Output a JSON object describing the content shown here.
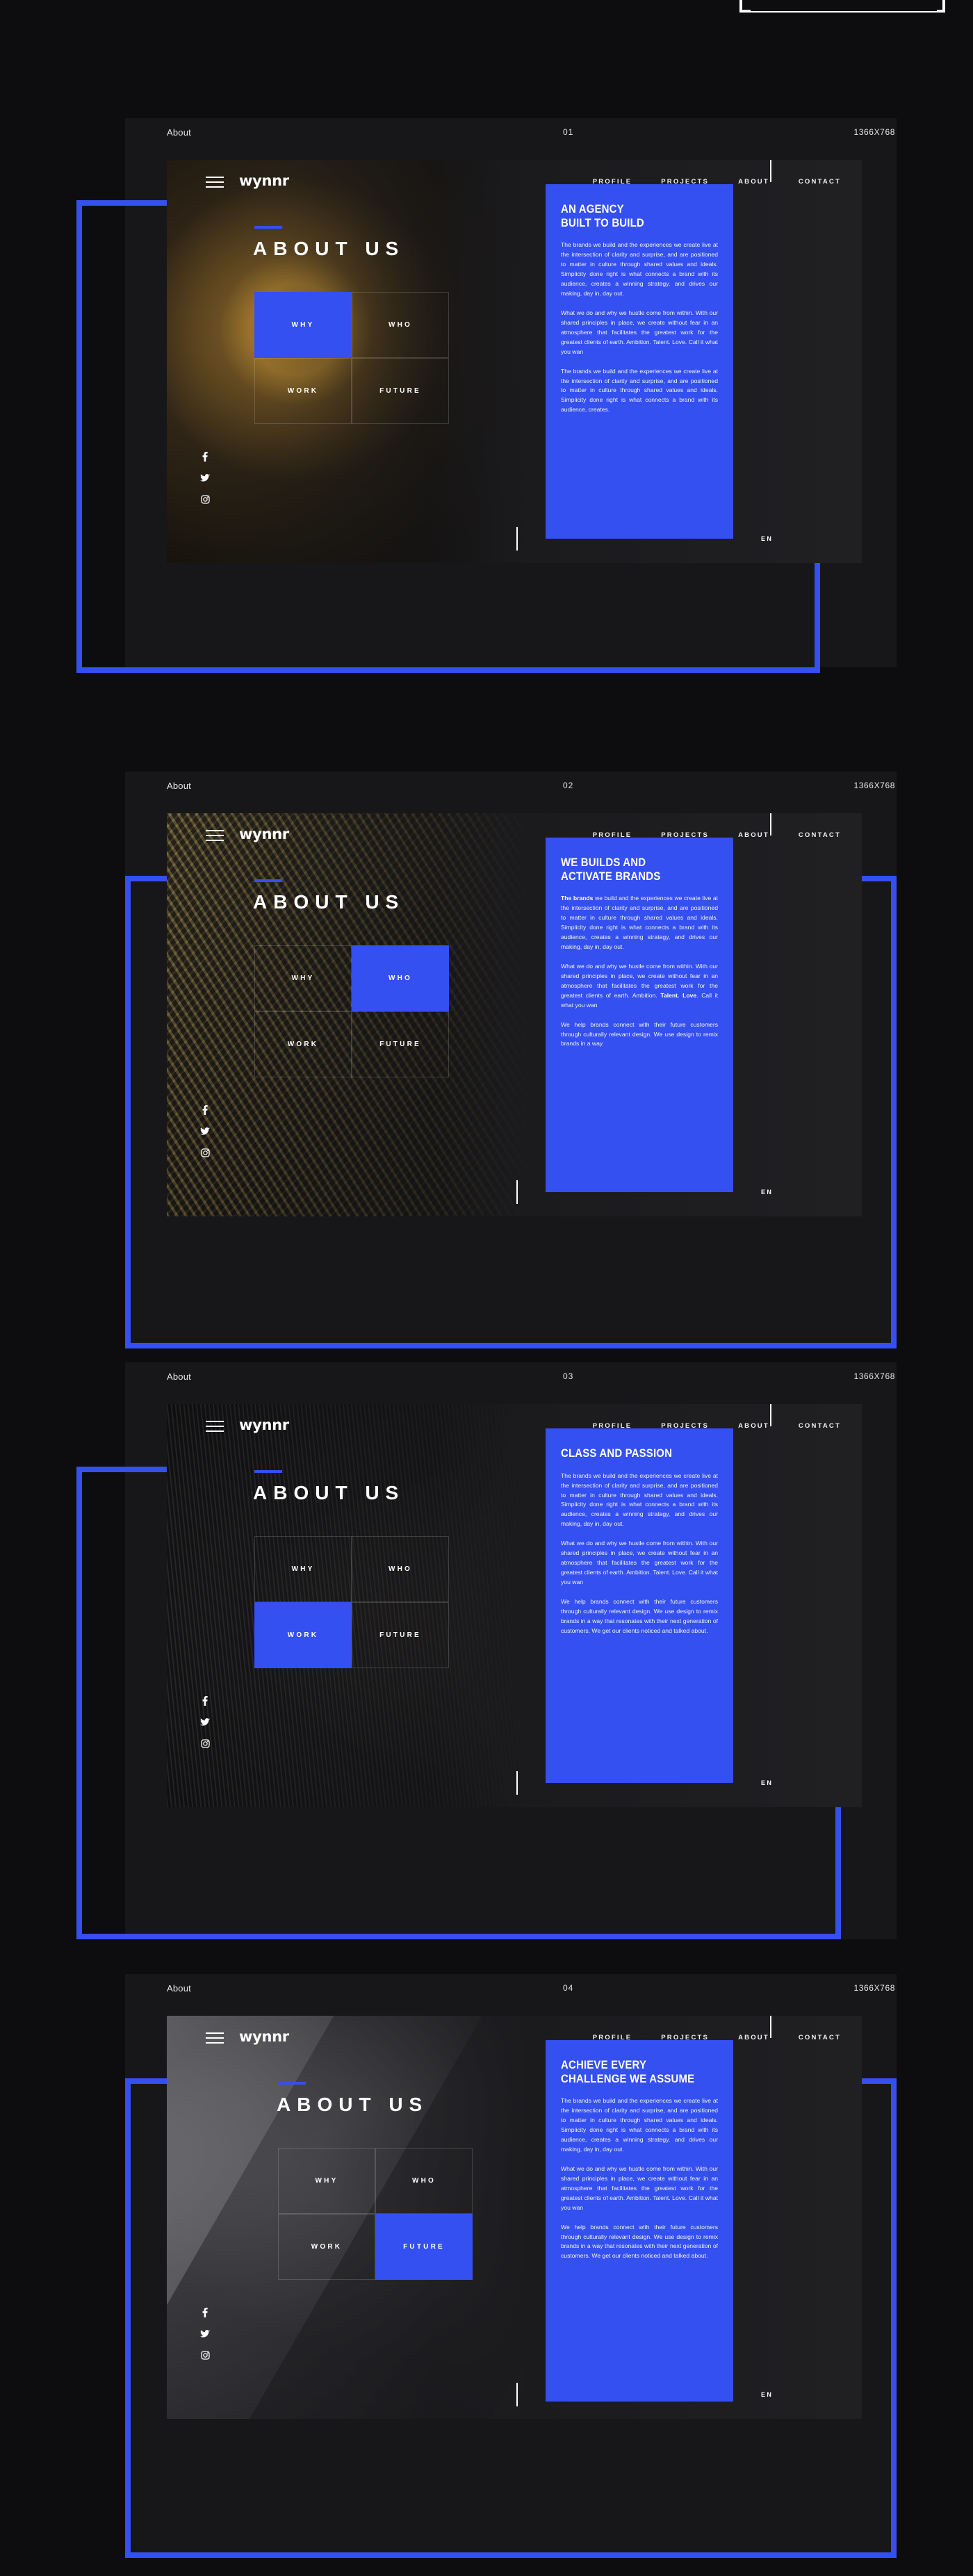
{
  "brand": "wynnr",
  "nav": {
    "links": [
      "PROFILE",
      "PROJECTS",
      "ABOUT",
      "CONTACT"
    ],
    "burger_icon": "hamburger-menu-icon"
  },
  "socials": [
    {
      "name": "facebook-icon",
      "glyph": "f"
    },
    {
      "name": "twitter-icon",
      "glyph": "t"
    },
    {
      "name": "instagram-icon",
      "glyph": "ig"
    }
  ],
  "language": "EN",
  "section_title": "ABOUT US",
  "grid_labels": [
    "WHY",
    "WHO",
    "WORK",
    "FUTURE"
  ],
  "paragraphs": {
    "p_brands": "The brands we build and the experiences we create live at the intersection of clarity and surprise, and are positioned to matter in culture through shared values and ideals. Simplicity done right is what connects a brand with its audience, creates a winning strategy, and drives our making, day in, day out.",
    "p_brands_short": "The brands we build and the experiences we create live at the intersection of clarity and surprise, and are positioned to matter in culture through shared values and ideals. Simplicity done right is what connects a brand with its audience, creates.",
    "p_hustle": "What we do and why we hustle come from within. With our shared principles in place, we create without fear in an atmosphere that facilitates the greatest work for the greatest clients of earth. Ambition. Talent. Love. Call it what you wan",
    "p_help_remix": "We help brands connect with their future customers through culturally relevant design. We use design to remix brands in a way.",
    "p_help_generation": "We help brands connect with their future customers through culturally relevant design. We use design to remix brands in a way that resonates with their next generation of customers. We get our clients noticed and talked about."
  },
  "mockups": [
    {
      "meta_left": "About",
      "meta_number": "01",
      "meta_resolution": "1366X768",
      "heading": "AN AGENCY\nBUILT TO BUILD",
      "active_cell": 0,
      "photo": "eye-with-golden-sunglasses-photo"
    },
    {
      "meta_left": "About",
      "meta_number": "02",
      "meta_resolution": "1366X768",
      "heading": "WE BUILDS AND ACTIVATE BRANDS",
      "active_cell": 1,
      "photo": "man-in-industrial-scaffolding-photo"
    },
    {
      "meta_left": "About",
      "meta_number": "03",
      "meta_resolution": "1366X768",
      "heading": "CLASS AND PASSION",
      "active_cell": 2,
      "photo": "person-walking-in-forest-photo"
    },
    {
      "meta_left": "About",
      "meta_number": "04",
      "meta_resolution": "1366X768",
      "heading": "ACHIEVE EVERY CHALLENGE WE ASSUME",
      "active_cell": 3,
      "photo": "person-with-camera-grayscale-photo"
    }
  ],
  "colors": {
    "accent_blue": "#3450f0",
    "page_background": "#0d0d0f",
    "panel_background": "#171719",
    "text_light": "#ffffff"
  }
}
